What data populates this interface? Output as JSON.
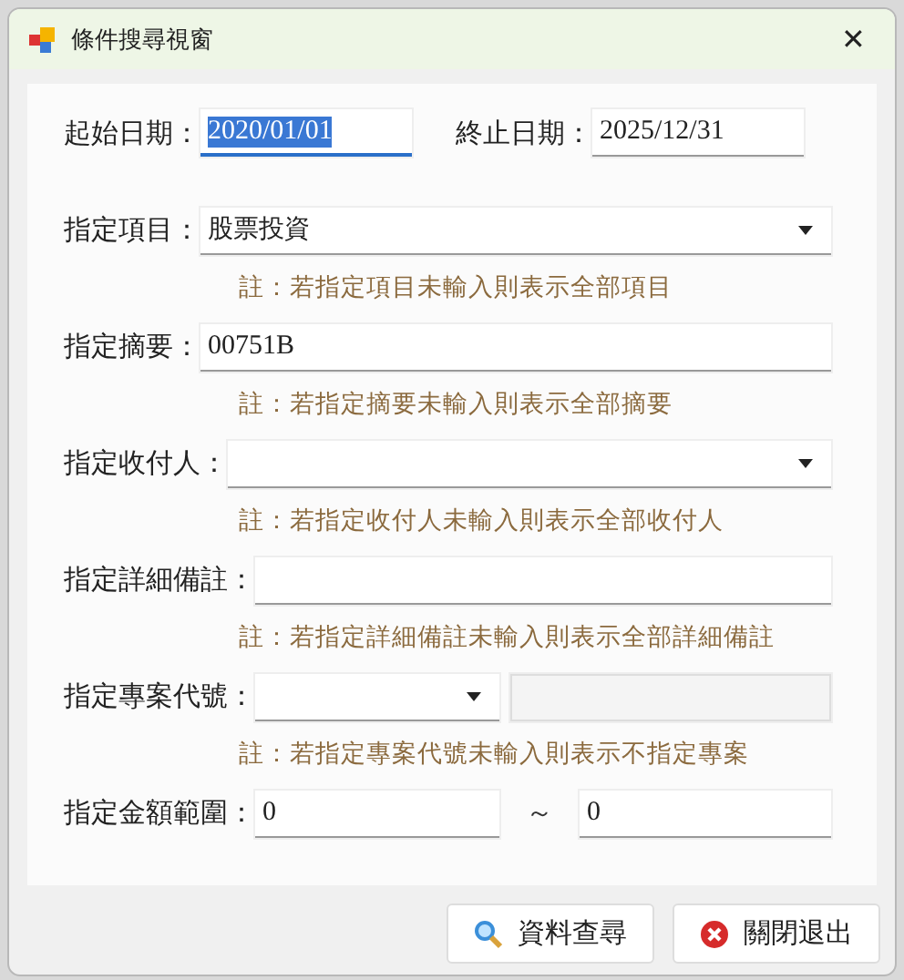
{
  "window": {
    "title": "條件搜尋視窗",
    "close": "✕"
  },
  "dates": [
    {
      "label": "起始日期：",
      "value": "2020/01/01",
      "focused": true
    },
    {
      "label": "終止日期：",
      "value": "2025/12/31",
      "focused": false
    }
  ],
  "fields": [
    {
      "kind": "combo",
      "label": "指定項目：",
      "value": "股票投資",
      "note": "註：若指定項目未輸入則表示全部項目"
    },
    {
      "kind": "text",
      "label": "指定摘要：",
      "value": "00751B",
      "note": "註：若指定摘要未輸入則表示全部摘要"
    },
    {
      "kind": "combo",
      "label": "指定收付人：",
      "note": "註：若指定收付人未輸入則表示全部收付人"
    },
    {
      "kind": "text",
      "label": "指定詳細備註：",
      "note": "註：若指定詳細備註未輸入則表示全部詳細備註"
    },
    {
      "kind": "combo_text",
      "label": "指定專案代號：",
      "note": "註：若指定專案代號未輸入則表示不指定專案"
    },
    {
      "kind": "range",
      "label": "指定金額範圍：",
      "from": "0",
      "separator": "～",
      "to": "0"
    }
  ],
  "buttons": [
    {
      "kind": "search",
      "label": "資料查尋"
    },
    {
      "kind": "close",
      "label": "關閉退出"
    }
  ]
}
